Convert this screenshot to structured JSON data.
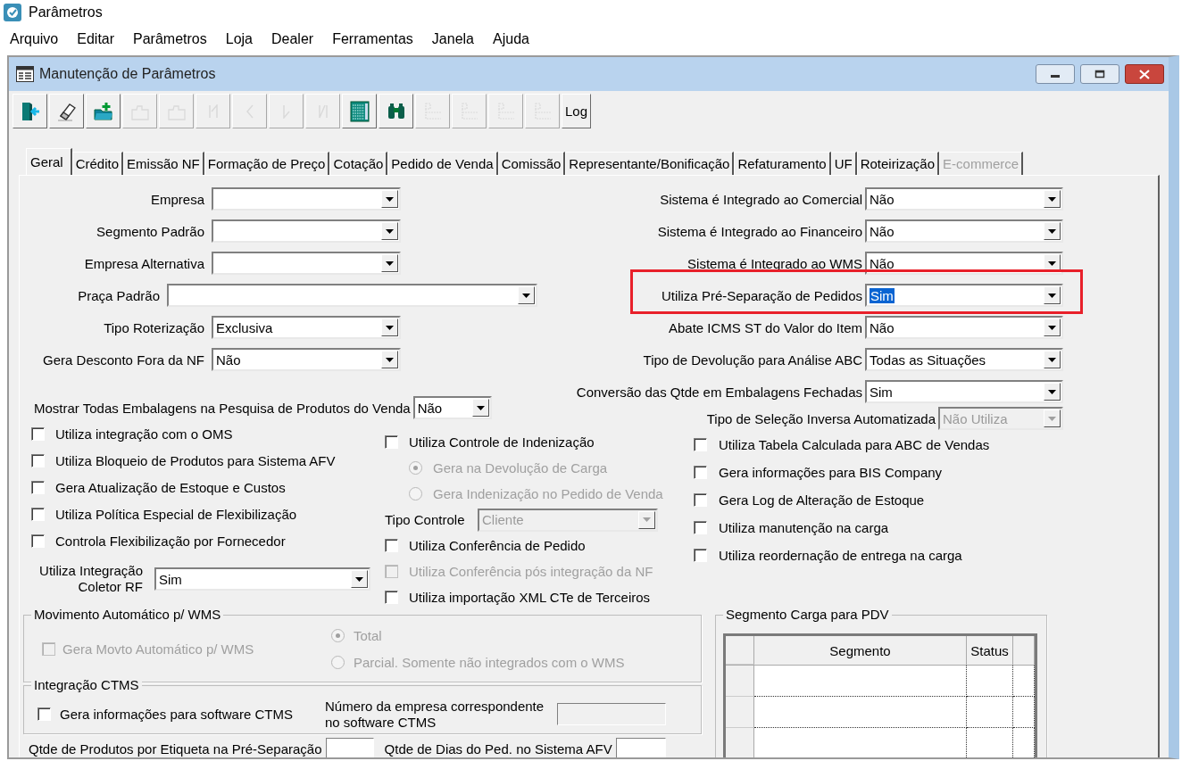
{
  "app": {
    "title": "Parâmetros"
  },
  "menu": [
    {
      "label": "Arquivo"
    },
    {
      "label": "Editar"
    },
    {
      "label": "Parâmetros"
    },
    {
      "label": "Loja"
    },
    {
      "label": "Dealer"
    },
    {
      "label": "Ferramentas"
    },
    {
      "label": "Janela"
    },
    {
      "label": "Ajuda"
    }
  ],
  "window": {
    "title": "Manutenção de Parâmetros"
  },
  "toolbar": [
    {
      "kind": "exit",
      "disabled": false
    },
    {
      "kind": "eraser",
      "disabled": false
    },
    {
      "kind": "new",
      "disabled": false
    },
    {
      "kind": "folder",
      "disabled": true
    },
    {
      "kind": "folder",
      "disabled": true
    },
    {
      "kind": "first",
      "disabled": true
    },
    {
      "kind": "previous",
      "disabled": true
    },
    {
      "kind": "next",
      "disabled": true
    },
    {
      "kind": "last",
      "disabled": true
    },
    {
      "kind": "grid",
      "disabled": false
    },
    {
      "kind": "find",
      "disabled": false
    },
    {
      "kind": "tree",
      "disabled": true
    },
    {
      "kind": "tree",
      "disabled": true
    },
    {
      "kind": "tree",
      "disabled": true
    },
    {
      "kind": "tree",
      "disabled": true
    },
    {
      "kind": "text",
      "label": "Log",
      "disabled": false
    }
  ],
  "tabs": [
    {
      "label": "Geral",
      "selected": true,
      "disabled": false
    },
    {
      "label": "Crédito",
      "selected": false,
      "disabled": false
    },
    {
      "label": "Emissão NF",
      "selected": false,
      "disabled": false
    },
    {
      "label": "Formação de Preço",
      "selected": false,
      "disabled": false
    },
    {
      "label": "Cotação",
      "selected": false,
      "disabled": false
    },
    {
      "label": "Pedido de Venda",
      "selected": false,
      "disabled": false
    },
    {
      "label": "Comissão",
      "selected": false,
      "disabled": false
    },
    {
      "label": "Representante/Bonificação",
      "selected": false,
      "disabled": false
    },
    {
      "label": "Refaturamento",
      "selected": false,
      "disabled": false
    },
    {
      "label": "UF",
      "selected": false,
      "disabled": false
    },
    {
      "label": "Roteirização",
      "selected": false,
      "disabled": false
    },
    {
      "label": "E-commerce",
      "selected": false,
      "disabled": true
    }
  ],
  "left_fields": [
    {
      "label": "Empresa",
      "kind": "short"
    },
    {
      "label": "Segmento Padrão",
      "kind": "short"
    },
    {
      "label": "Empresa Alternativa",
      "kind": "short"
    },
    {
      "label": "Praça Padrão",
      "kind": "long"
    },
    {
      "label": "Tipo Roterização",
      "value": "Exclusiva",
      "kind": "short"
    },
    {
      "label": "Gera Desconto Fora da NF",
      "value": "Não",
      "kind": "short"
    }
  ],
  "packaging_field": {
    "label": "Mostrar Todas Embalagens na Pesquisa de Produtos do Venda",
    "value": "Não"
  },
  "right_fields": [
    {
      "label": "Sistema é Integrado ao Comercial",
      "value": "Não",
      "highlighted": false
    },
    {
      "label": "Sistema é Integrado ao Financeiro",
      "value": "Não",
      "highlighted": false
    },
    {
      "label": "Sistema é Integrado ao WMS",
      "value": "Não",
      "highlighted": false
    },
    {
      "label": "Utiliza Pré-Separação de Pedidos",
      "value": "Sim",
      "highlighted": true
    },
    {
      "label": "Abate ICMS ST do Valor do Item",
      "value": "Não",
      "highlighted": false
    },
    {
      "label": "Tipo de Devolução para Análise ABC",
      "value": "Todas as Situações",
      "highlighted": false
    },
    {
      "label": "Conversão das Qtde em Embalagens Fechadas",
      "value": "Sim",
      "highlighted": false
    }
  ],
  "inverse_selection_field": {
    "label": "Tipo de Seleção Inversa Automatizada",
    "value": "Não Utiliza",
    "disabled": true
  },
  "options_col1": [
    {
      "kind": "checkbox",
      "label": "Utiliza integração com o OMS",
      "checked": false,
      "disabled": false
    },
    {
      "kind": "checkbox",
      "label": "Utiliza Bloqueio de Produtos para Sistema AFV",
      "checked": false,
      "disabled": false
    },
    {
      "kind": "checkbox",
      "label": "Gera Atualização de Estoque e Custos",
      "checked": false,
      "disabled": false
    },
    {
      "kind": "checkbox",
      "label": "Utiliza Política Especial de Flexibilização",
      "checked": false,
      "disabled": false
    },
    {
      "kind": "checkbox",
      "label": "Controla Flexibilização por Fornecedor",
      "checked": false,
      "disabled": false
    },
    {
      "kind": "dropdown",
      "label": "Utiliza Integração Coletor RF",
      "value": "Sim",
      "disabled": false
    }
  ],
  "options_col2": [
    {
      "kind": "checkbox",
      "label": "Utiliza Controle de Indenização",
      "checked": false,
      "disabled": false
    },
    {
      "kind": "radio",
      "label": "Gera na Devolução de Carga",
      "selected": true,
      "disabled": true
    },
    {
      "kind": "radio",
      "label": "Gera Indenização no Pedido de Venda",
      "selected": false,
      "disabled": true
    },
    {
      "kind": "dropdown",
      "label": "Tipo Controle",
      "value": "Cliente",
      "disabled": true
    },
    {
      "kind": "checkbox",
      "label": "Utiliza Conferência de Pedido",
      "checked": false,
      "disabled": false
    },
    {
      "kind": "checkbox",
      "label": "Utiliza Conferência pós integração da NF",
      "checked": false,
      "disabled": true
    },
    {
      "kind": "checkbox",
      "label": "Utiliza importação XML CTe de Terceiros",
      "checked": false,
      "disabled": false
    }
  ],
  "options_col3": [
    {
      "kind": "checkbox",
      "label": "Utiliza Tabela Calculada para ABC de Vendas",
      "checked": false,
      "disabled": false
    },
    {
      "kind": "checkbox",
      "label": "Gera informações para BIS Company",
      "checked": false,
      "disabled": false
    },
    {
      "kind": "checkbox",
      "label": "Gera Log de Alteração de Estoque",
      "checked": false,
      "disabled": false
    },
    {
      "kind": "checkbox",
      "label": "Utiliza manutenção na carga",
      "checked": false,
      "disabled": false
    },
    {
      "kind": "checkbox",
      "label": "Utiliza reordernação de entrega na carga",
      "checked": false,
      "disabled": false
    }
  ],
  "wms_group": {
    "title": "Movimento Automático p/ WMS",
    "items": [
      {
        "kind": "checkbox",
        "label": "Gera Movto Automático p/ WMS",
        "checked": false,
        "disabled": true
      },
      {
        "kind": "radio",
        "label": "Total",
        "selected": true,
        "disabled": true
      },
      {
        "kind": "radio",
        "label": "Parcial. Somente não integrados com o WMS",
        "selected": false,
        "disabled": true
      }
    ]
  },
  "ctms_group": {
    "title": "Integração CTMS",
    "items": [
      {
        "kind": "checkbox",
        "label": "Gera informações para software CTMS",
        "checked": false,
        "disabled": false
      },
      {
        "kind": "text_input",
        "label": "Número da empresa correspondente no software CTMS",
        "disabled": true
      }
    ]
  },
  "bottom_fields": [
    {
      "label": "Qtde de Produtos por Etiqueta na Pré-Separação"
    },
    {
      "label": "Qtde de Dias do Ped. no Sistema AFV"
    }
  ],
  "segment_group": {
    "title": "Segmento Carga para PDV",
    "columns": [
      "Segmento",
      "Status"
    ]
  }
}
